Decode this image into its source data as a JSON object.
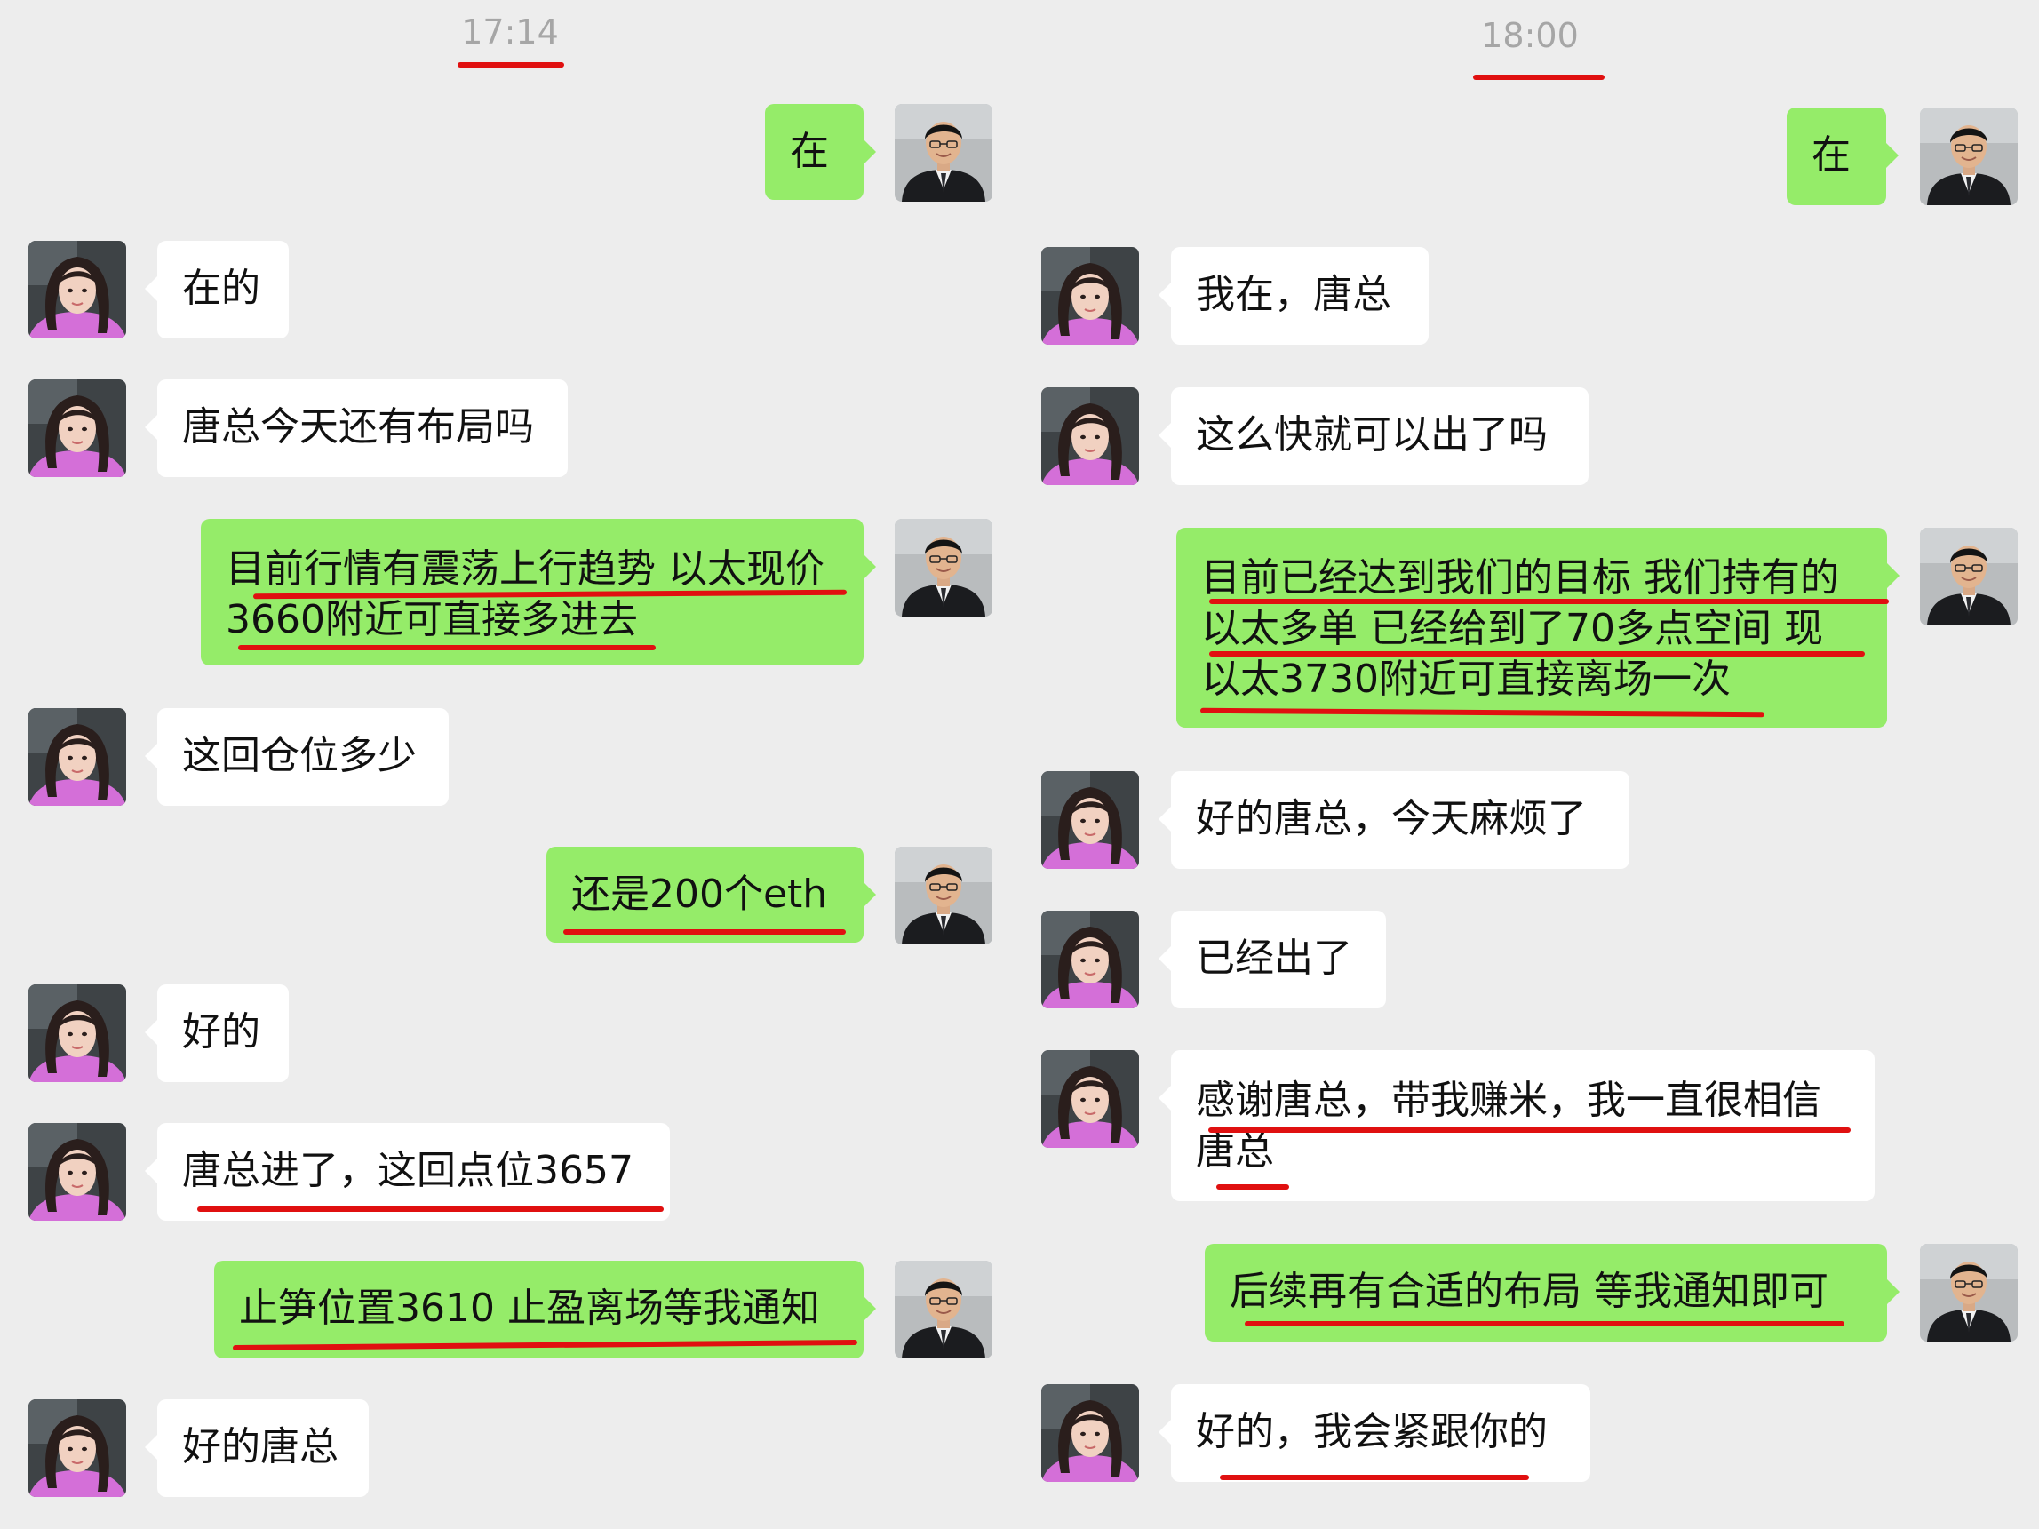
{
  "left": {
    "time": "17:14",
    "messages": [
      {
        "from": "me",
        "text": "在"
      },
      {
        "from": "other",
        "text": "在的"
      },
      {
        "from": "other",
        "text": "唐总今天还有布局吗"
      },
      {
        "from": "me",
        "text": "目前行情有震荡上行趋势 以太现价\n3660附近可直接多进去"
      },
      {
        "from": "other",
        "text": "这回仓位多少"
      },
      {
        "from": "me",
        "text": "还是200个eth"
      },
      {
        "from": "other",
        "text": "好的"
      },
      {
        "from": "other",
        "text": "唐总进了，这回点位3657"
      },
      {
        "from": "me",
        "text": "止笋位置3610  止盈离场等我通知"
      },
      {
        "from": "other",
        "text": "好的唐总"
      }
    ]
  },
  "right": {
    "time": "18:00",
    "messages": [
      {
        "from": "me",
        "text": "在"
      },
      {
        "from": "other",
        "text": "我在，唐总"
      },
      {
        "from": "other",
        "text": "这么快就可以出了吗"
      },
      {
        "from": "me",
        "text": "目前已经达到我们的目标 我们持有的\n以太多单 已经给到了70多点空间 现\n以太3730附近可直接离场一次"
      },
      {
        "from": "other",
        "text": "好的唐总，今天麻烦了"
      },
      {
        "from": "other",
        "text": "已经出了"
      },
      {
        "from": "other",
        "text": "感谢唐总，带我赚米，我一直很相信\n唐总"
      },
      {
        "from": "me",
        "text": "后续再有合适的布局 等我通知即可"
      },
      {
        "from": "other",
        "text": "好的，我会紧跟你的"
      }
    ]
  },
  "colors": {
    "background": "#ededed",
    "outgoing_bubble": "#95ec69",
    "incoming_bubble": "#ffffff",
    "timestamp": "#a6a6a6",
    "annotation_underline": "#e01010"
  }
}
